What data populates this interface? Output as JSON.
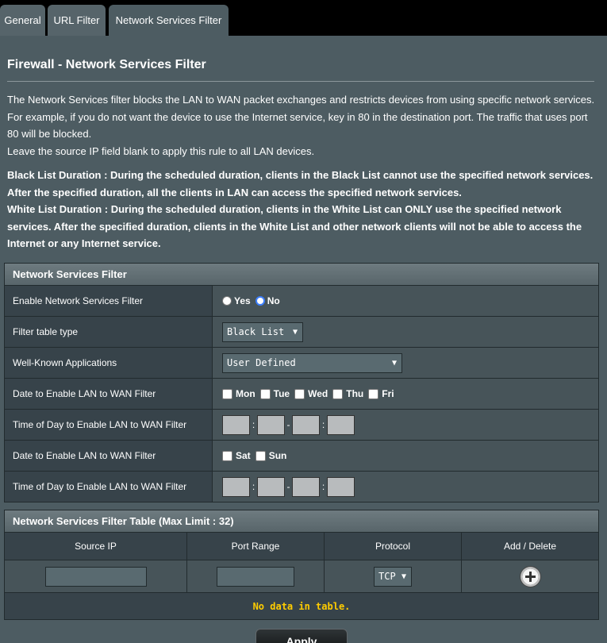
{
  "tabs": [
    {
      "label": "General"
    },
    {
      "label": "URL Filter"
    },
    {
      "label": "Network Services Filter"
    }
  ],
  "page": {
    "title": "Firewall - Network Services Filter",
    "desc1": "The Network Services filter blocks the LAN to WAN packet exchanges and restricts devices from using specific network services.",
    "desc2": "For example, if you do not want the device to use the Internet service, key in 80 in the destination port. The traffic that uses port 80 will be blocked.",
    "desc3": "Leave the source IP field blank to apply this rule to all LAN devices.",
    "black_list": "Black List Duration : During the scheduled duration, clients in the Black List cannot use the specified network services. After the specified duration, all the clients in LAN can access the specified network services.",
    "white_list": "White List Duration : During the scheduled duration, clients in the White List can ONLY use the specified network services. After the specified duration, clients in the White List and other network clients will not be able to access the Internet or any Internet service."
  },
  "settings": {
    "header": "Network Services Filter",
    "enable_label": "Enable Network Services Filter",
    "yes": "Yes",
    "no": "No",
    "table_type_label": "Filter table type",
    "table_type_value": "Black List",
    "apps_label": "Well-Known Applications",
    "apps_value": "User Defined",
    "date_weekday_label": "Date to Enable LAN to WAN Filter",
    "days_weekday": [
      "Mon",
      "Tue",
      "Wed",
      "Thu",
      "Fri"
    ],
    "time_weekday_label": "Time of Day to Enable LAN to WAN Filter",
    "date_weekend_label": "Date to Enable LAN to WAN Filter",
    "days_weekend": [
      "Sat",
      "Sun"
    ],
    "time_weekend_label": "Time of Day to Enable LAN to WAN Filter",
    "colon": ":",
    "dash": "-"
  },
  "filter_table": {
    "header": "Network Services Filter Table (Max Limit : 32)",
    "columns": [
      "Source IP",
      "Port Range",
      "Protocol",
      "Add / Delete"
    ],
    "protocol_value": "TCP",
    "empty": "No data in table."
  },
  "apply_label": "Apply"
}
